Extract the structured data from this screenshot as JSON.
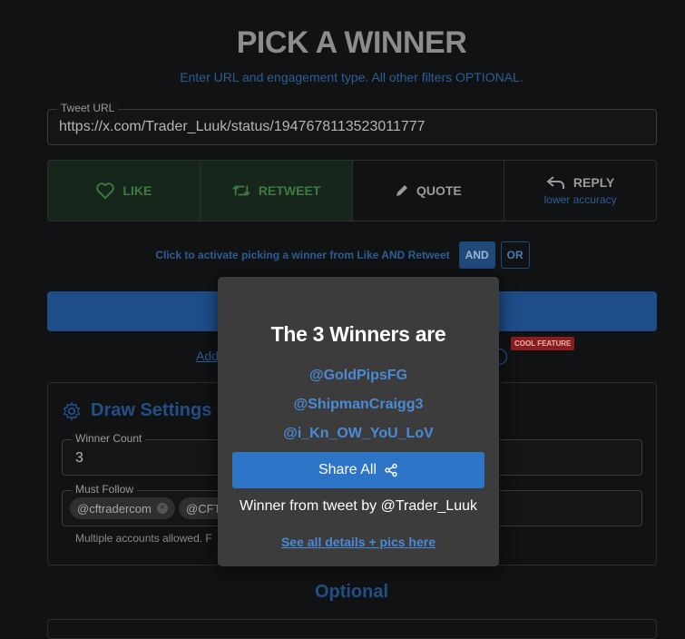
{
  "header": {
    "title": "PICK A WINNER",
    "subtitle": "Enter URL and engagement type. All other filters OPTIONAL."
  },
  "tweet_url": {
    "label": "Tweet URL",
    "value": "https://x.com/Trader_Luuk/status/1947678113523011777"
  },
  "engagement_types": [
    {
      "label": "LIKE",
      "icon": "heart-icon",
      "active": true
    },
    {
      "label": "RETWEET",
      "icon": "retweet-icon",
      "active": true
    },
    {
      "label": "QUOTE",
      "icon": "pencil-icon",
      "active": false
    },
    {
      "label": "REPLY",
      "icon": "reply-icon",
      "sub": "lower accuracy",
      "active": false
    }
  ],
  "logic": {
    "text": "Click to activate picking a winner from Like AND Retweet",
    "and_label": "AND",
    "or_label": "OR"
  },
  "add_link_partial": "Add",
  "cool_badge": "COOL FEATURE",
  "settings": {
    "title": "Draw Settings (",
    "winner_count_label": "Winner Count",
    "winner_count_value": "3",
    "must_follow_label": "Must Follow",
    "must_follow_chips": [
      "@cftradercom",
      "@CFT"
    ],
    "helper": "Multiple accounts allowed. F"
  },
  "optional_label": "Optional",
  "modal": {
    "title": "The 3 Winners are",
    "winners": [
      "@GoldPipsFG",
      "@ShipmanCraigg3",
      "@i_Kn_OW_YoU_LoV"
    ],
    "share_label": "Share All",
    "from_text": "Winner from tweet by @Trader_Luuk",
    "details_link": "See all details + pics here"
  },
  "colors": {
    "accent": "#2d74c6",
    "link": "#4a8ad6",
    "active_type": "#3e7a44",
    "badge": "#8a1d1d"
  }
}
